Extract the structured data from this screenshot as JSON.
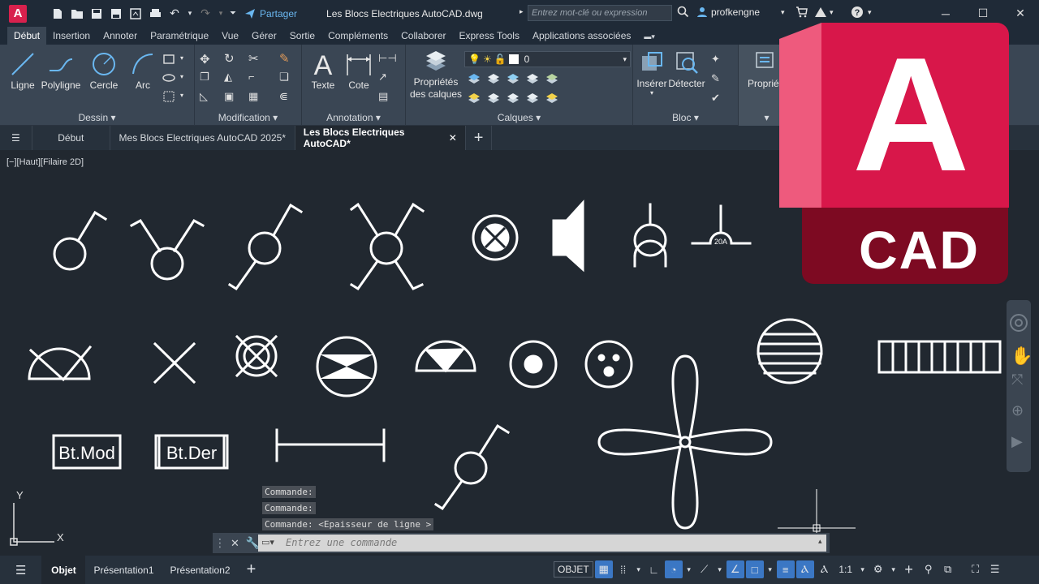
{
  "titlebar": {
    "app_icon": "A",
    "share_label": "Partager",
    "document_title": "Les Blocs Electriques AutoCAD.dwg",
    "search_placeholder": "Entrez mot-clé ou expression",
    "username": "profkengne"
  },
  "ribbon_tabs": [
    "Début",
    "Insertion",
    "Annoter",
    "Paramétrique",
    "Vue",
    "Gérer",
    "Sortie",
    "Compléments",
    "Collaborer",
    "Express Tools",
    "Applications associées"
  ],
  "ribbon": {
    "dessin": {
      "title": "Dessin",
      "tools": [
        "Ligne",
        "Polyligne",
        "Cercle",
        "Arc"
      ]
    },
    "modification": {
      "title": "Modification"
    },
    "annotation": {
      "title": "Annotation",
      "tools": [
        "Texte",
        "Cote"
      ]
    },
    "calques": {
      "title": "Calques",
      "props_label_1": "Propriétés",
      "props_label_2": "des calques",
      "current_layer": "0"
    },
    "bloc": {
      "title": "Bloc",
      "tools": [
        "Insérer",
        "Détecter"
      ]
    },
    "proprietes": {
      "label": "Propriét"
    }
  },
  "doc_tabs": [
    "Début",
    "Mes Blocs Electriques AutoCAD 2025*",
    "Les Blocs Electriques AutoCAD*"
  ],
  "viewport_label": "[−][Haut][Filaire 2D]",
  "drawing": {
    "breaker_label": "20A",
    "box_label_1": "Bt.Mod",
    "box_label_2": "Bt.Der",
    "axis_y": "Y",
    "axis_x": "X"
  },
  "command": {
    "history": [
      "Commande:",
      "Commande:",
      "Commande:  <Epaisseur de ligne >"
    ],
    "placeholder": "Entrez une commande"
  },
  "status": {
    "layout_tabs": [
      "Objet",
      "Présentation1",
      "Présentation2"
    ],
    "model_label": "OBJET",
    "scale": "1:1"
  },
  "logo": {
    "letter": "A",
    "word": "CAD"
  },
  "colors": {
    "accent": "#d8214d",
    "background": "#212830",
    "ribbon": "#3a4654"
  }
}
